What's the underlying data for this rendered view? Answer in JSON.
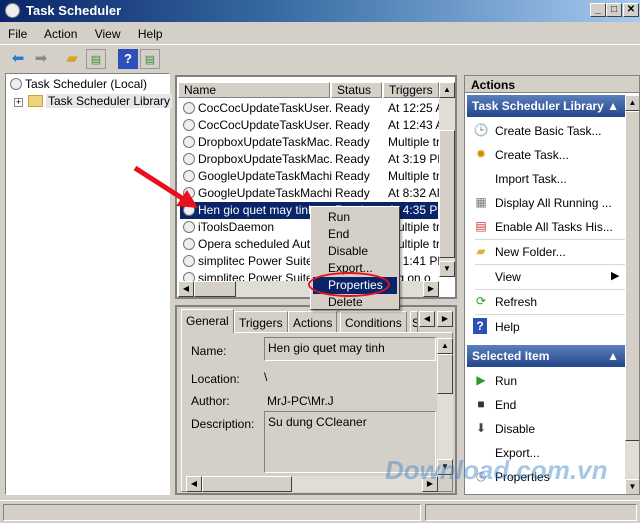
{
  "window": {
    "title": "Task Scheduler",
    "minimize": "_",
    "maximize": "□",
    "close": "✕"
  },
  "menu": [
    "File",
    "Action",
    "View",
    "Help"
  ],
  "toolbar": {
    "icons": [
      "back-arrow-icon",
      "forward-arrow-icon",
      "folder-up-icon",
      "show-hide-tree-icon",
      "help-icon",
      "show-hide-action-pane-icon"
    ]
  },
  "tree": {
    "root": "Task Scheduler (Local)",
    "child": "Task Scheduler Library",
    "expander": "+"
  },
  "list": {
    "columns": [
      "Name",
      "Status",
      "Triggers"
    ],
    "rows": [
      {
        "name": "CocCocUpdateTaskUser...",
        "status": "Ready",
        "triggers": "At 12:25 A"
      },
      {
        "name": "CocCocUpdateTaskUser...",
        "status": "Ready",
        "triggers": "At 12:43 A"
      },
      {
        "name": "DropboxUpdateTaskMac...",
        "status": "Ready",
        "triggers": "Multiple tri"
      },
      {
        "name": "DropboxUpdateTaskMac...",
        "status": "Ready",
        "triggers": "At 3:19 PM"
      },
      {
        "name": "GoogleUpdateTaskMachi...",
        "status": "Ready",
        "triggers": "Multiple tri"
      },
      {
        "name": "GoogleUpdateTaskMachi...",
        "status": "Ready",
        "triggers": "At 8:32 AM"
      },
      {
        "name": "Hen gio quet may tinh",
        "status": "Ready",
        "triggers": "At 4:35 PM"
      },
      {
        "name": "iToolsDaemon",
        "status": "",
        "triggers": "Multiple tri"
      },
      {
        "name": "Opera scheduled Autou",
        "status": "",
        "triggers": "Multiple tri"
      },
      {
        "name": "simplitec Power Suite",
        "status": "",
        "triggers": "At 1:41 PM"
      },
      {
        "name": "simplitec Power Suite (",
        "status": "",
        "triggers": "log on o"
      }
    ],
    "selected_index": 6
  },
  "context_menu": {
    "items": [
      "Run",
      "End",
      "Disable",
      "Export...",
      "Properties",
      "Delete"
    ],
    "highlighted": "Properties"
  },
  "details": {
    "tabs": [
      "General",
      "Triggers",
      "Actions",
      "Conditions",
      "S"
    ],
    "active_tab": "General",
    "name_label": "Name:",
    "name_value": "Hen gio quet may tinh",
    "location_label": "Location:",
    "location_value": "\\",
    "author_label": "Author:",
    "author_value": "MrJ-PC\\Mr.J",
    "description_label": "Description:",
    "description_value": "Su dung CCleaner"
  },
  "actions": {
    "header": "Actions",
    "library_section": "Task Scheduler Library",
    "library_items": [
      "Create Basic Task...",
      "Create Task...",
      "Import Task...",
      "Display All Running ...",
      "Enable All Tasks His...",
      "New Folder...",
      "View",
      "Refresh",
      "Help"
    ],
    "selected_section": "Selected Item",
    "selected_items": [
      "Run",
      "End",
      "Disable",
      "Export...",
      "Properties"
    ]
  },
  "watermark": "Download.com.vn",
  "annotation_color": "#e8101a"
}
